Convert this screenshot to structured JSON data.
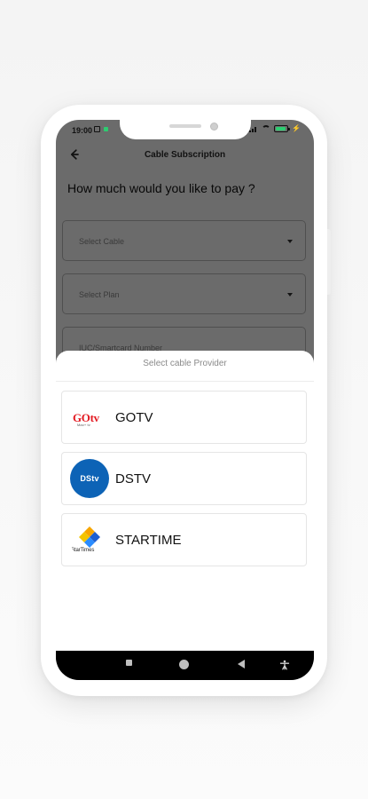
{
  "device": {
    "status_bar": {
      "time": "19:00"
    },
    "system_navigation": {
      "recent_icon": "square-icon",
      "home_icon": "home-circle-icon",
      "back_icon": "back-triangle-icon",
      "accessibility_icon": "accessibility-icon"
    }
  },
  "app": {
    "header": {
      "title": "Cable Subscription",
      "back_icon": "back-arrow-icon"
    },
    "form": {
      "question": "How much would you like to pay ?",
      "fields": [
        {
          "label": "Select Cable",
          "icon": "dropdown-icon"
        },
        {
          "label": "Select Plan",
          "icon": "dropdown-icon"
        },
        {
          "label": "IUC/Smartcard Number"
        }
      ]
    },
    "bottom_sheet": {
      "title": "Select cable Provider",
      "providers": [
        {
          "name": "GOTV",
          "logo_text": "GOtv",
          "logo_subtext": "Max+ tv",
          "logo_color": "#e31b23"
        },
        {
          "name": "DSTV",
          "logo_text": "DStv",
          "logo_color": "#0d63b6"
        },
        {
          "name": "STARTIME",
          "logo_text": "StarTimes",
          "logo_colors": [
            "#f7a500",
            "#1d5fd1",
            "#f3c400",
            "#2a8cff"
          ]
        }
      ]
    }
  },
  "colors": {
    "overlay": "#000000",
    "surface": "#ffffff",
    "text_primary": "#111111",
    "text_secondary": "#8a8a8a",
    "border": "#bdbdbd"
  }
}
